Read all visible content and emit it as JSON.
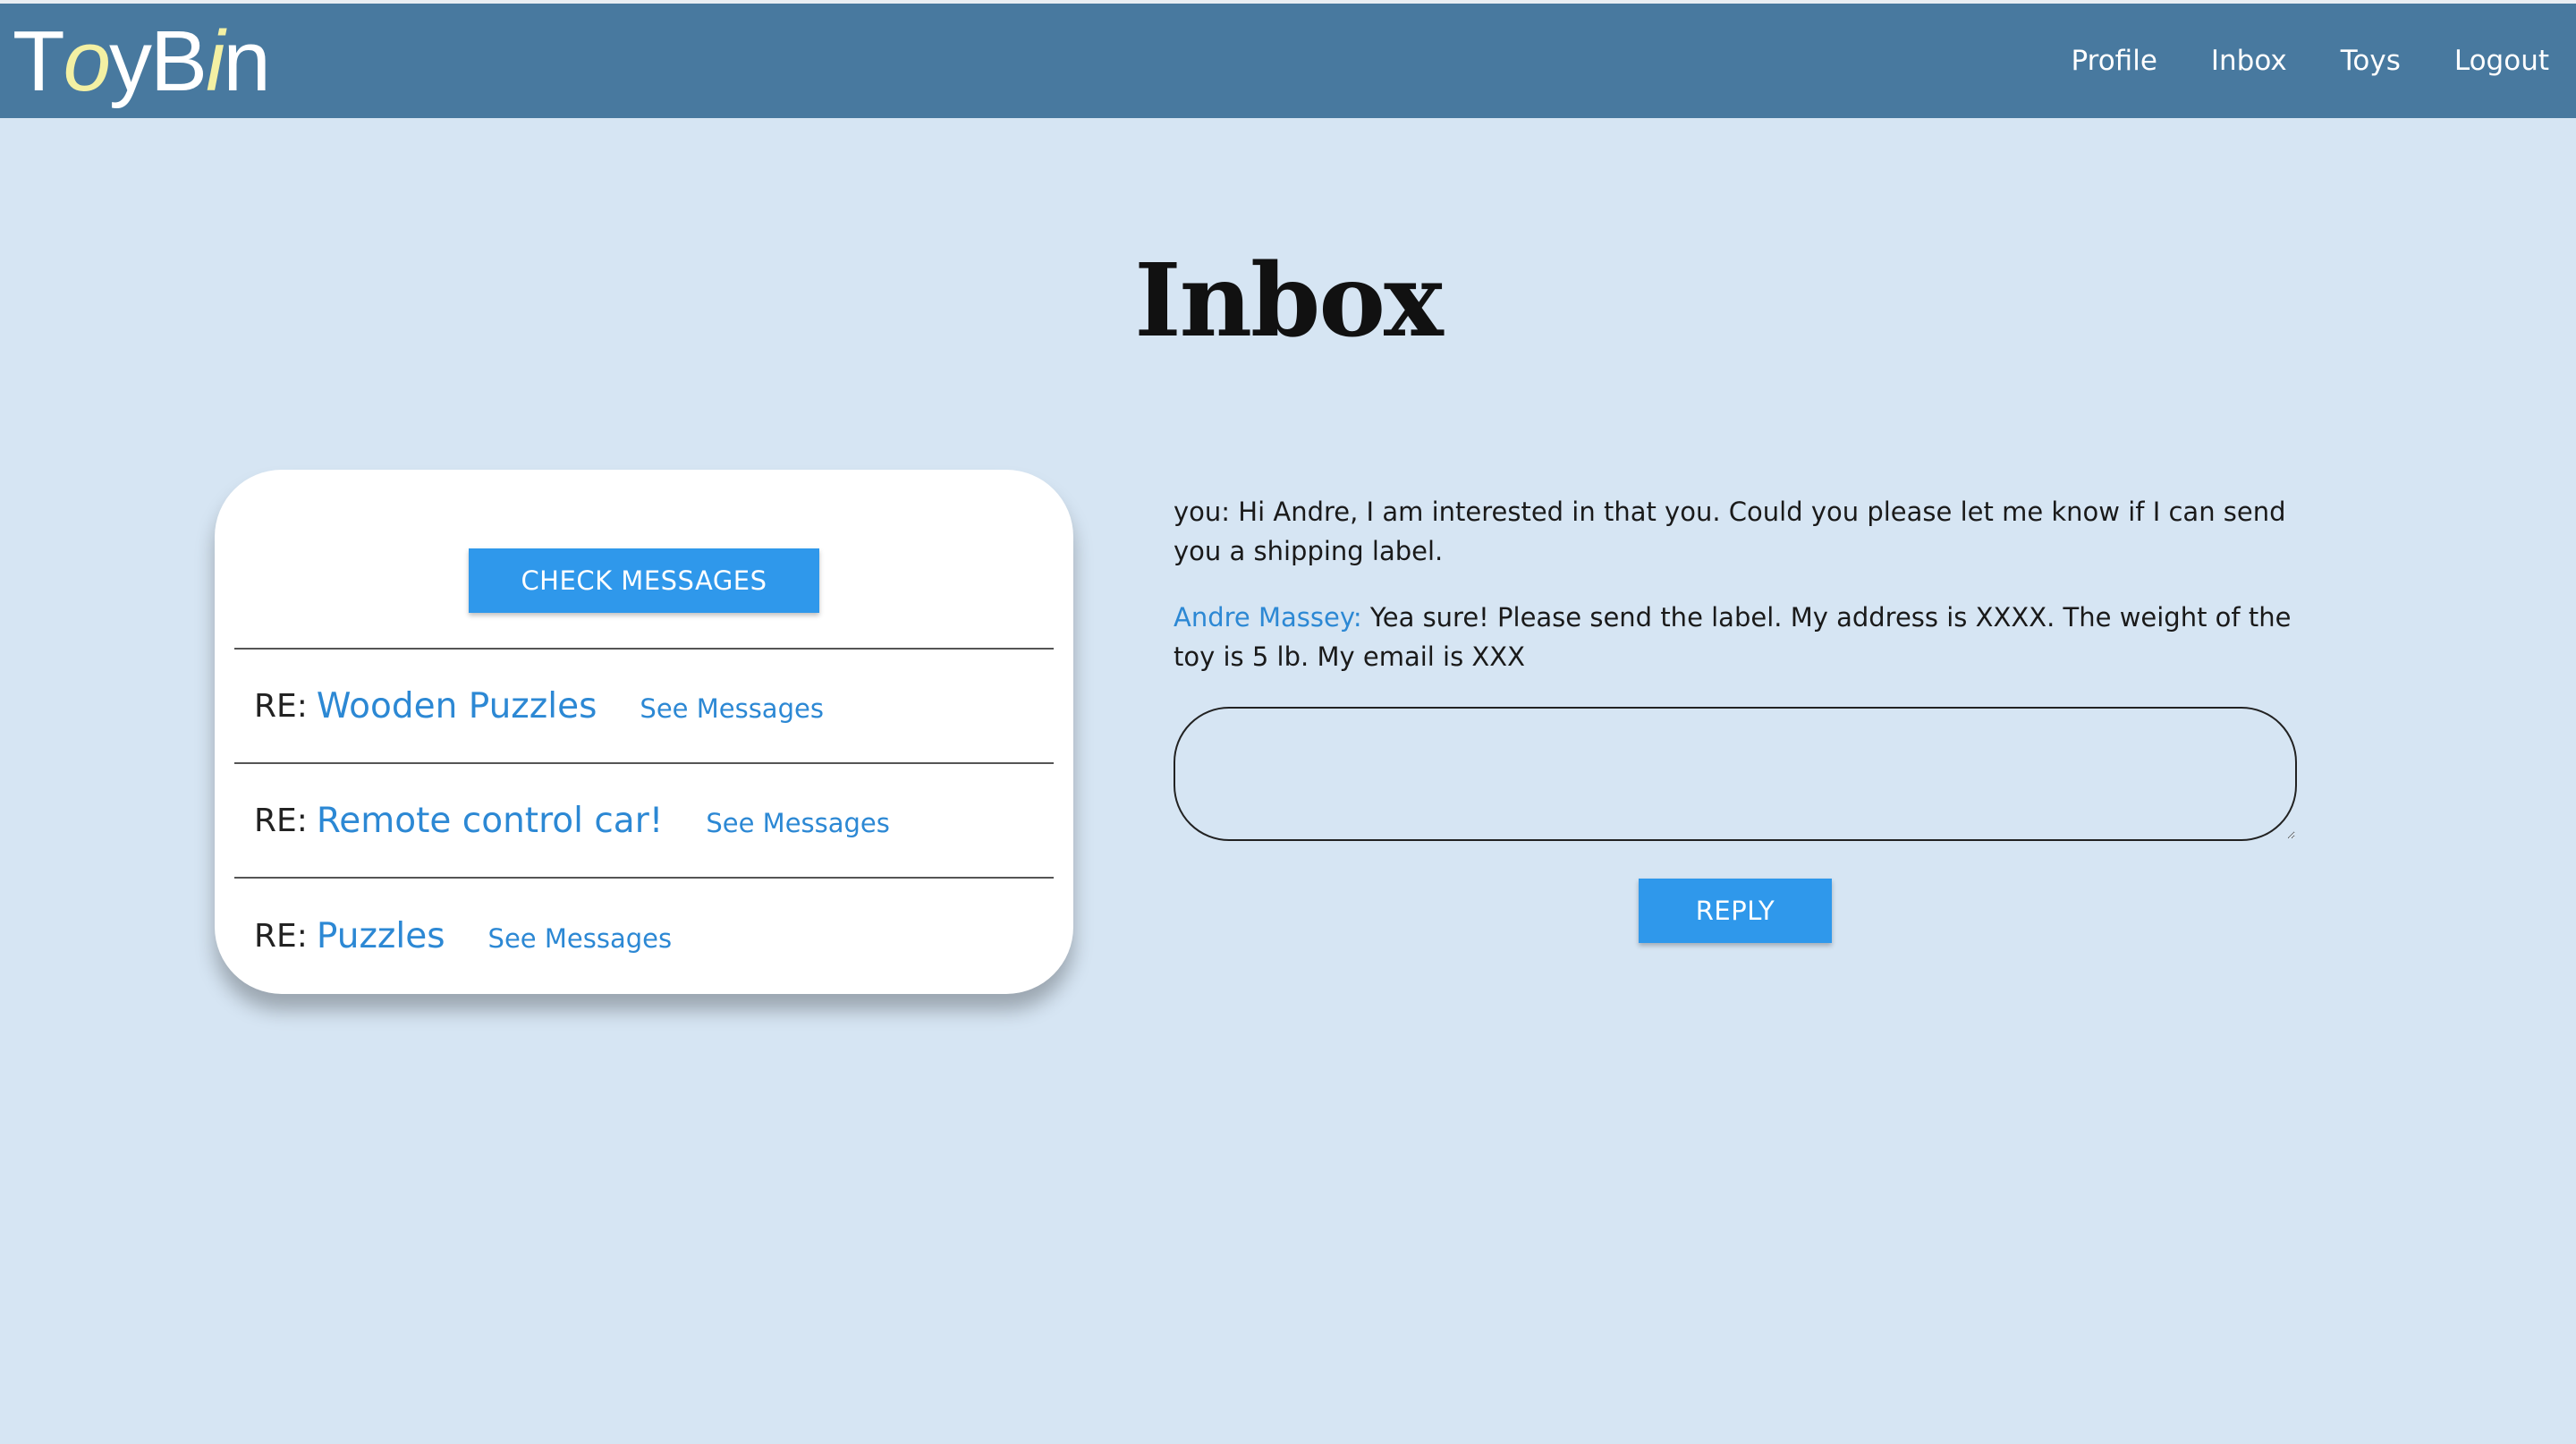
{
  "brand": {
    "logo_parts": [
      "T",
      "o",
      "yB",
      "i",
      "n"
    ]
  },
  "nav": {
    "items": [
      "Profile",
      "Inbox",
      "Toys",
      "Logout"
    ]
  },
  "page": {
    "title": "Inbox"
  },
  "inbox": {
    "check_button": "CHECK MESSAGES",
    "threads": [
      {
        "prefix": "RE:",
        "subject": "Wooden Puzzles",
        "link": "See Messages"
      },
      {
        "prefix": "RE:",
        "subject": "Remote control car!",
        "link": "See Messages"
      },
      {
        "prefix": "RE:",
        "subject": "Puzzles",
        "link": "See Messages"
      }
    ]
  },
  "conversation": {
    "messages": [
      {
        "sender": "you:",
        "text": "Hi Andre, I am interested in that you. Could you please let me know if I can send you a shipping label."
      },
      {
        "sender": "Andre Massey:",
        "text": "Yea sure! Please send the label. My address is XXXX. The weight of the toy is 5 lb. My email is XXX"
      }
    ],
    "reply_value": "",
    "reply_button": "REPLY"
  },
  "colors": {
    "header": "#48799f",
    "background": "#d6e5f3",
    "accent": "#2f98eb",
    "link": "#2c88d4",
    "logo_accent": "#f3f0a3"
  }
}
